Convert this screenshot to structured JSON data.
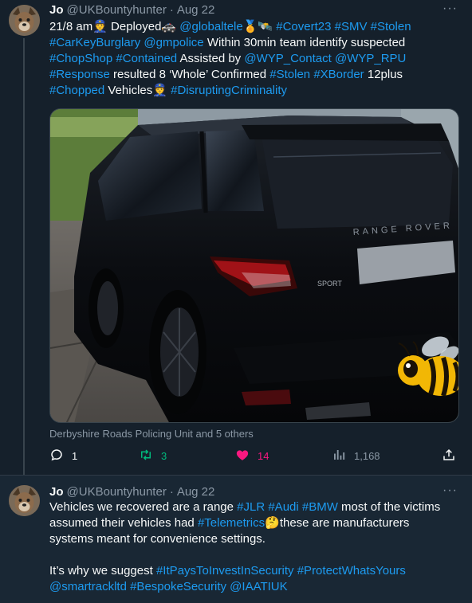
{
  "tweets": [
    {
      "author": "Jo",
      "handle": "@UKBountyhunter",
      "separator": "·",
      "date": "Aug 22",
      "more": "···",
      "segments": [
        {
          "t": "21/8 am👮 Deployed🚓 "
        },
        {
          "t": "@globaltele",
          "link": true
        },
        {
          "t": "🏅🛰️ "
        },
        {
          "t": "#Covert23",
          "link": true
        },
        {
          "t": " "
        },
        {
          "t": "#SMV",
          "link": true
        },
        {
          "t": " "
        },
        {
          "t": "#Stolen",
          "link": true
        },
        {
          "t": "\n"
        },
        {
          "t": "#CarKeyBurglary",
          "link": true
        },
        {
          "t": " "
        },
        {
          "t": "@gmpolice",
          "link": true
        },
        {
          "t": " Within 30min team identify suspected\n"
        },
        {
          "t": "#ChopShop",
          "link": true
        },
        {
          "t": " "
        },
        {
          "t": "#Contained",
          "link": true
        },
        {
          "t": " Assisted by "
        },
        {
          "t": "@WYP_Contact",
          "link": true
        },
        {
          "t": " "
        },
        {
          "t": "@WYP_RPU",
          "link": true
        },
        {
          "t": "\n"
        },
        {
          "t": "#Response",
          "link": true
        },
        {
          "t": " resulted 8 ‘Whole’ Confirmed "
        },
        {
          "t": "#Stolen",
          "link": true
        },
        {
          "t": " "
        },
        {
          "t": "#XBorder",
          "link": true
        },
        {
          "t": " 12plus\n"
        },
        {
          "t": "#Chopped",
          "link": true
        },
        {
          "t": " Vehicles👮 "
        },
        {
          "t": "#DisruptingCriminality",
          "link": true
        }
      ],
      "media_caption": "Derbyshire Roads Policing Unit and 5 others",
      "stats": {
        "replies": "1",
        "retweets": "3",
        "likes": "14",
        "views": "1,168"
      }
    },
    {
      "author": "Jo",
      "handle": "@UKBountyhunter",
      "separator": "·",
      "date": "Aug 22",
      "more": "···",
      "segments": [
        {
          "t": "Vehicles we recovered are a range "
        },
        {
          "t": "#JLR",
          "link": true
        },
        {
          "t": " "
        },
        {
          "t": "#Audi",
          "link": true
        },
        {
          "t": " "
        },
        {
          "t": "#BMW",
          "link": true
        },
        {
          "t": " most of the victims\nassumed their vehicles had "
        },
        {
          "t": "#Telemetrics",
          "link": true
        },
        {
          "t": "🤔these are manufacturers\nsystems meant for convenience settings.\n\nIt’s why we suggest "
        },
        {
          "t": "#ItPaysToInvestInSecurity",
          "link": true
        },
        {
          "t": " "
        },
        {
          "t": "#ProtectWhatsYours",
          "link": true
        },
        {
          "t": "\n"
        },
        {
          "t": "@smartrackltd",
          "link": true
        },
        {
          "t": " "
        },
        {
          "t": "#BespokeSecurity",
          "link": true
        },
        {
          "t": " "
        },
        {
          "t": "@IAATIUK",
          "link": true
        }
      ]
    }
  ],
  "media": {
    "plate_text": "RANGE ROVER",
    "badge_text": "SPORT",
    "sticker": "bee-sticker"
  },
  "colors": {
    "background": "#15202b",
    "link": "#1d9bf0",
    "muted": "#8b98a5",
    "retweet": "#00ba7c",
    "like": "#f91880"
  },
  "icons": [
    "reply-icon",
    "retweet-icon",
    "heart-icon",
    "views-icon",
    "share-icon",
    "more-icon"
  ]
}
